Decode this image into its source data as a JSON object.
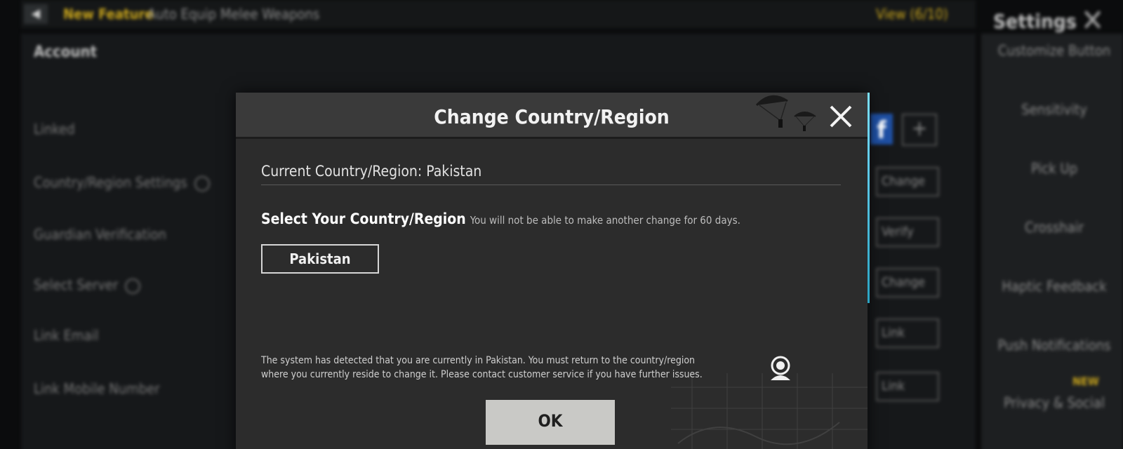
{
  "background": {
    "topbar": {
      "back_icon": "back-arrow-icon",
      "news_tag": "New Feature",
      "news_text": "Auto Equip Melee Weapons",
      "view_link": "View (6/10)"
    },
    "settings_title": "Settings",
    "account_header": "Account",
    "account_rows": [
      "Linked",
      "Country/Region Settings",
      "Guardian Verification",
      "Select Server",
      "Link Email",
      "Link Mobile Number"
    ],
    "side_buttons": [
      "Change",
      "Verify",
      "Change",
      "Link",
      "Link"
    ],
    "right_menu": [
      "Customize Button",
      "Sensitivity",
      "Pick Up",
      "Crosshair",
      "Haptic Feedback",
      "Push Notifications",
      "Privacy & Social"
    ],
    "new_badge": "NEW"
  },
  "dialog": {
    "title": "Change Country/Region",
    "current_label": "Current Country/Region: Pakistan",
    "select_label": "Select Your Country/Region",
    "select_note": "You will not be able to make another change for 60 days.",
    "selected_country": "Pakistan",
    "notice": "The system has detected that you are currently in Pakistan. You must return to the country/region where you currently reside to change it. Please contact customer service if you have further issues.",
    "ok_label": "OK",
    "icons": {
      "close": "close-icon",
      "support": "customer-service-icon",
      "decor": "parachute-icon"
    },
    "accent_color": "#5fd3f0"
  }
}
